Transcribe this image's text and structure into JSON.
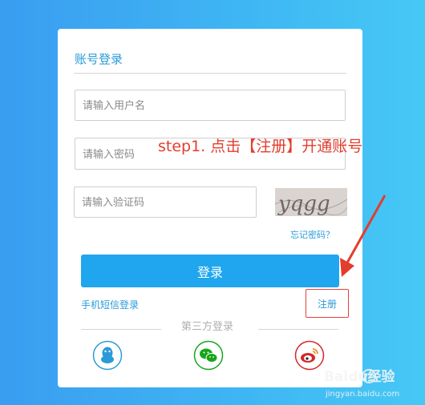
{
  "login_form": {
    "title": "账号登录",
    "username_placeholder": "请输入用户名",
    "password_placeholder": "请输入密码",
    "captcha_placeholder": "请输入验证码",
    "captcha_text": "yqgg",
    "forgot_password": "忘记密码？",
    "login_button": "登录",
    "sms_login": "手机短信登录",
    "register_button": "注册",
    "third_party_label": "第三方登录",
    "social_icons": [
      "qq-icon",
      "wechat-icon",
      "weibo-icon"
    ]
  },
  "annotation": {
    "text": "step1. 点击【注册】开通账号",
    "color": "#e23d2d"
  },
  "watermark": {
    "brand": "Baidu经验",
    "url": "jingyan.baidu.com"
  },
  "colors": {
    "accent": "#1fa6ef",
    "link": "#2a9bd8",
    "register_border": "#e0443a"
  }
}
